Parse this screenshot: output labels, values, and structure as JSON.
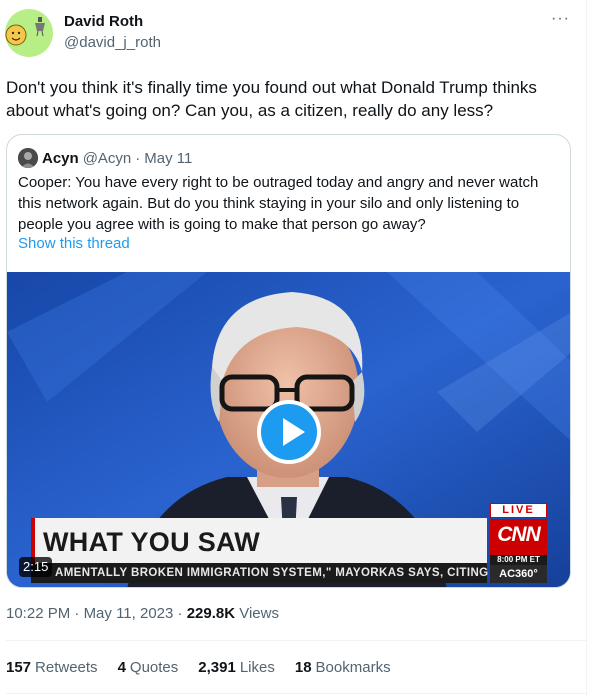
{
  "author": {
    "name": "David Roth",
    "handle": "@david_j_roth",
    "avatar_icon": "smiley-avatar-icon",
    "avatar_color": "#b7ef86"
  },
  "more_label": "···",
  "tweet_text": "Don't you think it's finally time you found out what Donald Trump thinks about what's going on? Can you, as a citizen, really do any less?",
  "quote": {
    "name": "Acyn",
    "handle": "@Acyn",
    "separator": "·",
    "date": "May 11",
    "text": "Cooper: You have every right to be outraged today and angry and never watch this network again. But do you think staying in your silo and only listening to people you agree with is going to make that person go away?",
    "thread_link": "Show this thread",
    "video": {
      "duration": "2:15",
      "chyron": "WHAT YOU SAW",
      "ticker": "AMENTALLY BROKEN IMMIGRATION SYSTEM,\" MAYORKAS SAYS, CITING",
      "live_label": "LIVE",
      "network": "CNN",
      "air_time": "8:00 PM ET",
      "show": "AC360°",
      "play_icon": "play-icon",
      "accent": "#1d9bf0"
    }
  },
  "meta": {
    "time": "10:22 PM",
    "dot1": "·",
    "date": "May 11, 2023",
    "dot2": "·",
    "views_count": "229.8K",
    "views_label": "Views"
  },
  "stats": [
    {
      "count": "157",
      "label": "Retweets"
    },
    {
      "count": "4",
      "label": "Quotes"
    },
    {
      "count": "2,391",
      "label": "Likes"
    },
    {
      "count": "18",
      "label": "Bookmarks"
    }
  ]
}
